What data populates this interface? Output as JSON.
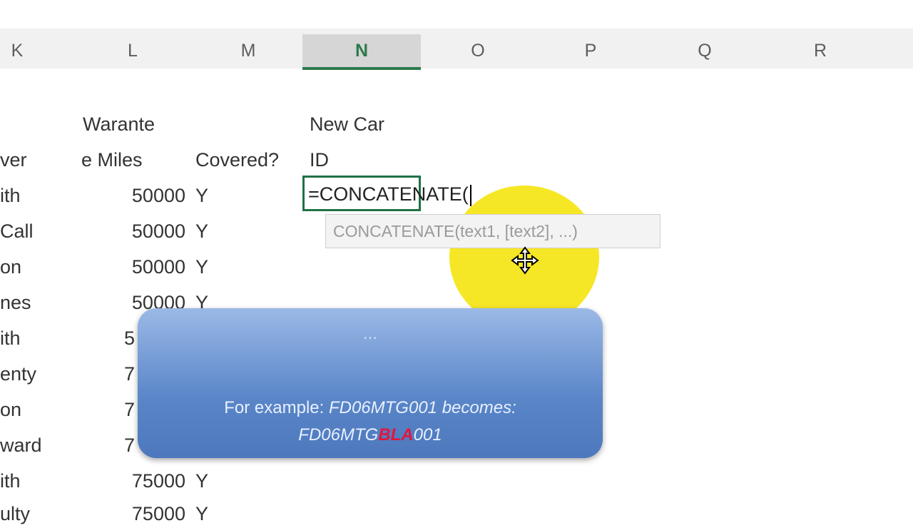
{
  "column_headers": [
    "K",
    "L",
    "M",
    "N",
    "O",
    "P",
    "Q",
    "R"
  ],
  "active_column": "N",
  "headers": {
    "warante": "Warante",
    "miles": "e Miles",
    "covered": "Covered?",
    "newcar": "New Car",
    "id": "ID",
    "driver": "ver"
  },
  "rows": [
    {
      "a": "ith",
      "miles": "50000",
      "cov": "Y"
    },
    {
      "a": "Call",
      "miles": "50000",
      "cov": "Y"
    },
    {
      "a": "on",
      "miles": "50000",
      "cov": "Y"
    },
    {
      "a": "nes",
      "miles": "50000",
      "cov": "Y"
    },
    {
      "a": "ith",
      "miles": "5",
      "cov": ""
    },
    {
      "a": "enty",
      "miles": "7",
      "cov": ""
    },
    {
      "a": "on",
      "miles": "7",
      "cov": ""
    },
    {
      "a": "ward",
      "miles": "7",
      "cov": ""
    },
    {
      "a": "ith",
      "miles": "75000",
      "cov": "Y"
    },
    {
      "a": "ulty",
      "miles": "75000",
      "cov": "Y"
    }
  ],
  "formula": {
    "value": "=CONCATENATE(",
    "tooltip": "CONCATENATE(text1, [text2], ...)"
  },
  "callout": {
    "line1": "...",
    "line2_prefix": "For example: ",
    "line2_code": "FD06MTG001 becomes:",
    "line3_a": "FD06MTG",
    "line3_b": "BLA",
    "line3_c": "001"
  },
  "colors": {
    "active_col": "#2b7a4b",
    "highlight": "#f5e61a",
    "callout": "#5a86c8",
    "example_red": "#e1173f"
  }
}
